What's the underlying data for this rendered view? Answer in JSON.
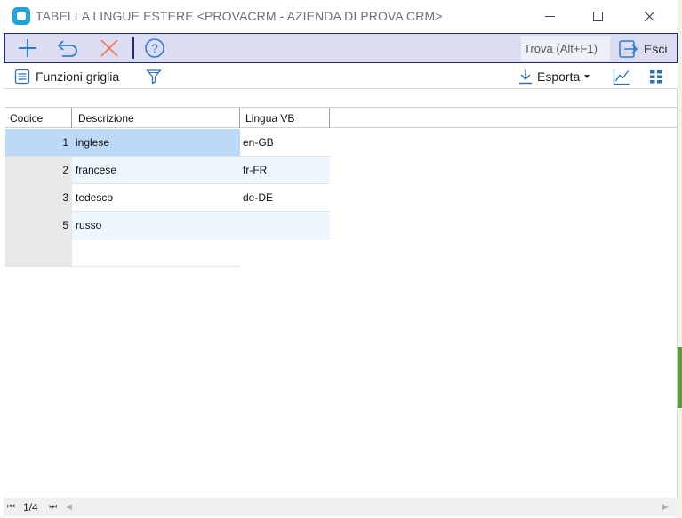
{
  "window": {
    "title": "TABELLA LINGUE ESTERE <PROVACRM - AZIENDA DI PROVA CRM>",
    "controls": [
      "minimize",
      "maximize",
      "close"
    ]
  },
  "toolbar": {
    "icons": [
      "add-icon",
      "undo-icon",
      "delete-icon",
      "help-icon"
    ],
    "search_label": "Trova (Alt+F1)",
    "exit_label": "Esci",
    "accent_color": "#1a2b7a",
    "background_color": "#dcdcf2"
  },
  "subtoolbar": {
    "grid_functions_label": "Funzioni griglia",
    "export_label": "Esporta"
  },
  "grid": {
    "columns": [
      "Codice",
      "Descrizione",
      "Lingua VB"
    ],
    "rows": [
      {
        "code": "1",
        "description": "inglese",
        "lang": "en-GB",
        "selected": true
      },
      {
        "code": "2",
        "description": "francese",
        "lang": "fr-FR"
      },
      {
        "code": "3",
        "description": "tedesco",
        "lang": "de-DE"
      },
      {
        "code": "5",
        "description": "russo",
        "lang": ""
      }
    ],
    "selection_color": "#bcdaf6"
  },
  "status": {
    "page": "1/4"
  }
}
